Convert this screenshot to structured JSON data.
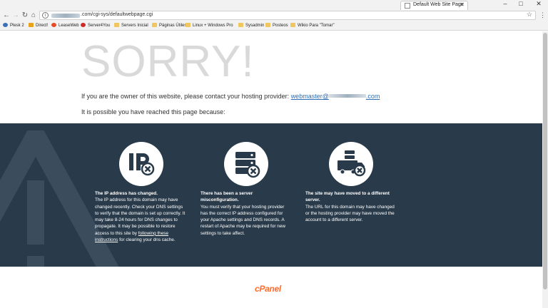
{
  "browser": {
    "tab_title": "Default Web Site Page",
    "url_visible": ".com/cgi-sys/defaultwebpage.cgi",
    "window_controls": [
      "–",
      "□",
      "✕"
    ],
    "bookmarks": [
      {
        "label": "Plesk 2",
        "color": "#3b6fb6"
      },
      {
        "label": "Direct!",
        "color": "#e8a31a"
      },
      {
        "label": "LeaseWeb",
        "color": "#e34c26"
      },
      {
        "label": "Server4You",
        "color": "#cf2a2a"
      },
      {
        "label": "Servers Inicial",
        "color": "#f0c75e"
      },
      {
        "label": "Páginas Útiles",
        "color": "#f0c75e"
      },
      {
        "label": "Linux + Windows Pro",
        "color": "#f0c75e"
      },
      {
        "label": "Sysadmin",
        "color": "#f0c75e"
      },
      {
        "label": "Posteos",
        "color": "#f0c75e"
      },
      {
        "label": "Wikio Para \"Tomar\"",
        "color": "#f0c75e"
      }
    ]
  },
  "page": {
    "heading": "SORRY!",
    "owner_text": "If you are the owner of this website, please contact your hosting provider:",
    "email_prefix": "webmaster@",
    "email_suffix": ".com",
    "reason_text": "It is possible you have reached this page because:",
    "columns": [
      {
        "icon": "ip-x-icon",
        "title": "The IP address has changed.",
        "body": "The IP address for this domain may have changed recently. Check your DNS settings to verify that the domain is set up correctly. It may take 8-24 hours for DNS changes to propagate. It may be possible to restore access to this site by",
        "link": "following these instructions",
        "tail": "for clearing your dns cache."
      },
      {
        "icon": "server-x-icon",
        "title": "There has been a server misconfiguration.",
        "body": "You must verify that your hosting provider has the correct IP address configured for your Apache settings and DNS records. A restart of Apache may be required for new settings to take affect."
      },
      {
        "icon": "moving-truck-icon",
        "title": "The site may have moved to a different server.",
        "body": "The URL for this domain may have changed or the hosting provider may have moved the account to a different server."
      }
    ],
    "footer_logo": "cPanel"
  },
  "colors": {
    "dark_band": "#293a4a",
    "heading": "#d9d9d9",
    "link": "#2d6db6",
    "cpanel": "#ff6c2c"
  }
}
